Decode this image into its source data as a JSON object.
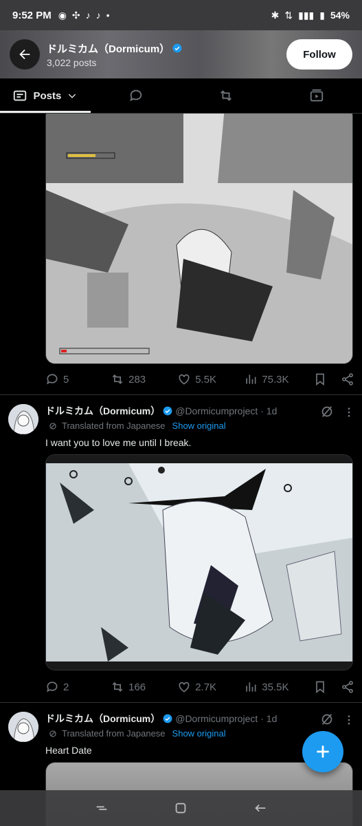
{
  "status_bar": {
    "time": "9:52 PM",
    "battery": "54%"
  },
  "header": {
    "name": "ドルミカム（Dormicum）",
    "posts": "3,022 posts",
    "follow_label": "Follow"
  },
  "tabs": [
    {
      "label": "Posts",
      "icon": "posts-icon"
    },
    {
      "icon": "replies-icon"
    },
    {
      "icon": "reposts-icon"
    },
    {
      "icon": "media-icon"
    }
  ],
  "tweets": [
    {
      "replies": "5",
      "reposts": "283",
      "likes": "5.5K",
      "views": "75.3K"
    },
    {
      "name": "ドルミカム（Dormicum）",
      "handle": "@Dormicumproject",
      "time": "· 1d",
      "translated": "Translated from Japanese",
      "show_original": "Show original",
      "text": "I want you to love me until I break.",
      "replies": "2",
      "reposts": "166",
      "likes": "2.7K",
      "views": "35.5K"
    },
    {
      "name": "ドルミカム（Dormicum）",
      "handle": "@Dormicumproject",
      "time": "· 1d",
      "translated": "Translated from Japanese",
      "show_original": "Show original",
      "text": "Heart Date"
    }
  ],
  "colors": {
    "accent": "#1d9bf0",
    "background": "#000000",
    "muted": "#71767b"
  }
}
